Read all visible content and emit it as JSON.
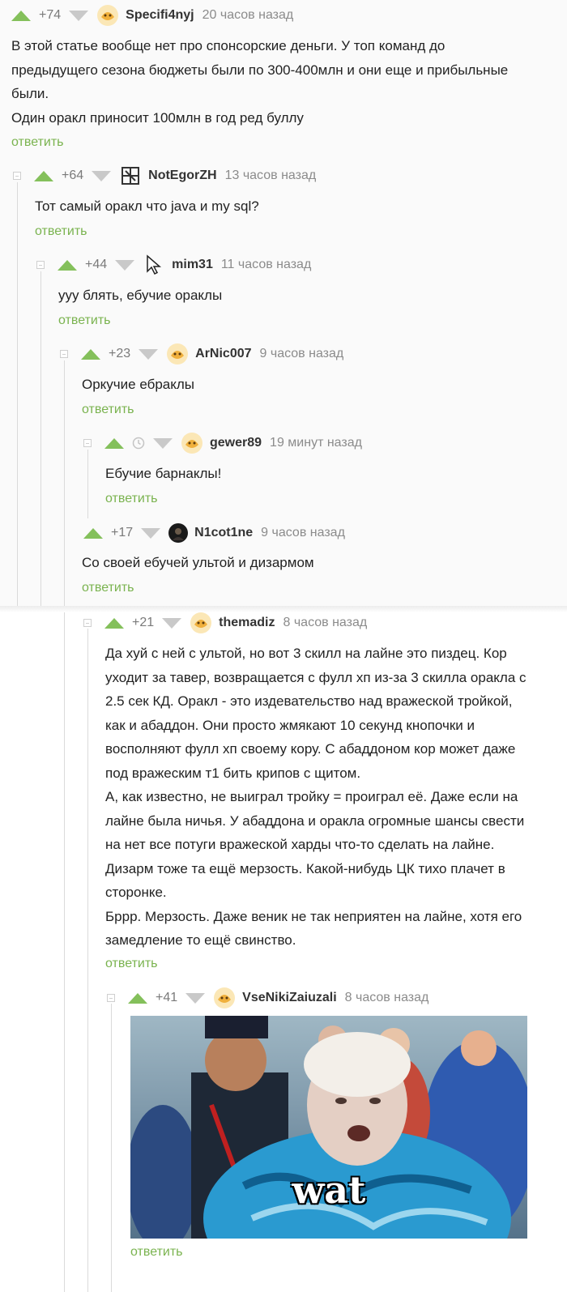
{
  "colors": {
    "upvote": "#84c05b",
    "downvote": "#c9c9c9",
    "reply_link": "#7ab34f",
    "meta_text": "#8b8b8b"
  },
  "comments": [
    {
      "rating": "+74",
      "nick": "Specifi4nyj",
      "time": "20 часов назад",
      "avatar": "default-avatar-icon",
      "text": [
        "В этой статье вообще нет про спонсорские деньги. У топ команд до",
        "предыдущего сезона бюджеты были по 300-400млн и они еще и прибыльные",
        "были.",
        "Один оракл приносит 100млн в год ред буллу"
      ],
      "reply": "ответить"
    },
    {
      "rating": "+64",
      "nick": "NotEgorZH",
      "time": "13 часов назад",
      "avatar": "logo-avatar-icon",
      "text": [
        "Тот самый оракл что java и my sql?"
      ],
      "reply": "ответить"
    },
    {
      "rating": "+44",
      "nick": "mim31",
      "time": "11 часов назад",
      "avatar": "cursor-avatar-icon",
      "text": [
        "ууу блять, ебучие ораклы"
      ],
      "reply": "ответить"
    },
    {
      "rating": "+23",
      "nick": "ArNic007",
      "time": "9 часов назад",
      "avatar": "default-avatar-icon",
      "text": [
        "Оркучие ебраклы"
      ],
      "reply": "ответить"
    },
    {
      "rating": "",
      "nick": "gewer89",
      "time": "19 минут назад",
      "avatar": "default-avatar-icon",
      "text": [
        "Ебучие барнаклы!"
      ],
      "reply": "ответить"
    },
    {
      "rating": "+17",
      "nick": "N1cot1ne",
      "time": "9 часов назад",
      "avatar": "dark-avatar-icon",
      "text": [
        "Со своей ебучей ультой и дизармом"
      ],
      "reply": "ответить"
    },
    {
      "rating": "+21",
      "nick": "themadiz",
      "time": "8 часов назад",
      "avatar": "default-avatar-icon",
      "text": [
        "Да хуй с ней с ультой, но вот 3 скилл на лайне это пиздец. Кор",
        "уходит за тавер, возвращается с фулл хп из-за 3 скилла оракла с",
        "2.5 сек КД. Оракл - это издевательство над вражеской тройкой,",
        "как и абаддон. Они просто жмякают 10 секунд кнопочки и",
        "восполняют фулл хп своему кору. С абаддоном кор может даже",
        "под вражеским т1 бить крипов с щитом.",
        "А, как известно, не выиграл тройку = проиграл её. Даже если на",
        "лайне была ничья. У абаддона и оракла огромные шансы свести",
        "на нет все потуги вражеской харды что-то сделать на лайне.",
        "Дизарм тоже та ещё мерзость. Какой-нибудь ЦК тихо плачет в",
        "сторонке.",
        "Бррр. Мерзость. Даже веник не так неприятен на лайне, хотя его",
        "замедление то ещё свинство."
      ],
      "reply": "ответить"
    },
    {
      "rating": "+41",
      "nick": "VseNikiZaiuzali",
      "time": "8 часов назад",
      "avatar": "default-avatar-icon",
      "text": [],
      "image_caption": "wat",
      "reply": "ответить"
    }
  ]
}
